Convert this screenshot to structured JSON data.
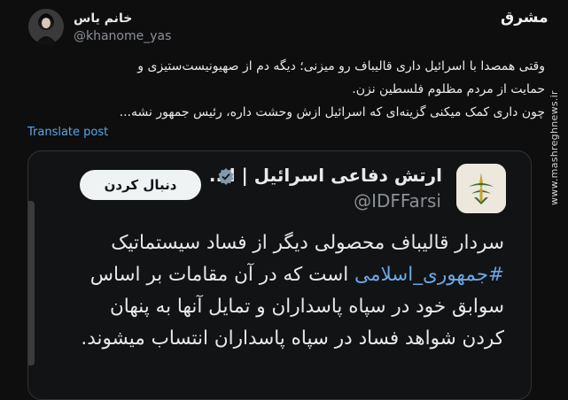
{
  "author": {
    "name": "خانم یاس",
    "handle": "@khanome_yas"
  },
  "watermark": {
    "logo": "مشرق",
    "vertical": "www.mashreghnews.ir"
  },
  "tweet": {
    "line1": "وقتی همصدا با اسرائیل داری قالیباف رو میزنی؛ دیگه دم از صهیونیست‌ستیزی و",
    "line2": "حمایت از مردم مظلوم فلسطین نزن.",
    "line3": "چون داری کمک میکنی گزینه‌ای که اسرائیل ازش وحشت داره، رئیس جمهور نشه..."
  },
  "translate_label": "Translate post",
  "quote": {
    "name": "ارتش دفاعی اسرائیل | ا...",
    "handle": "@IDFFarsi",
    "follow_label": "دنبال کردن",
    "line1": "سردار قالیباف محصولی دیگر از فساد سیستماتیک",
    "hashtag": "#جمهوری_اسلامی",
    "line2_rest": "است که در آن مقامات بر اساس",
    "line3": "سوابق خود در سپاه پاسداران و تمایل آنها به پنهان",
    "line4": "کردن شواهد فساد در سپاه پاسداران انتساب میشوند."
  },
  "colors": {
    "background": "#0e0e0f",
    "link": "#5ba7e6",
    "hashtag": "#6aa8e8",
    "verified": "#829aab"
  },
  "icons": [
    "avatar-image",
    "verified-badge-icon",
    "idf-emblem-icon"
  ]
}
